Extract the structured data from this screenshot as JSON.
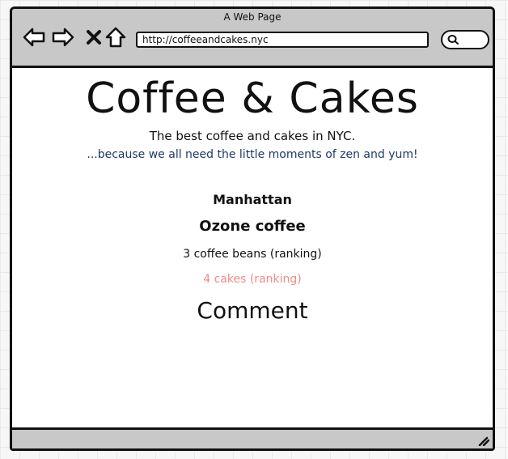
{
  "window": {
    "title": "A Web Page"
  },
  "toolbar": {
    "back_icon": "back-arrow-icon",
    "forward_icon": "forward-arrow-icon",
    "stop_icon": "close-icon",
    "home_icon": "home-icon",
    "search_icon": "search-icon"
  },
  "address_bar": {
    "url": "http://coffeeandcakes.nyc"
  },
  "page": {
    "title": "Coffee & Cakes",
    "subtitle": "The best coffee and cakes in NYC.",
    "tagline": "...because we all need the little moments of zen and yum!",
    "neighborhood": "Manhattan",
    "shop_name": "Ozone coffee",
    "coffee_rank": "3 coffee beans (ranking)",
    "cake_rank": "4 cakes (ranking)",
    "comment_heading": "Comment"
  },
  "colors": {
    "tagline": "#1f3a66",
    "cake_rank": "#f08a8a",
    "chrome": "#c8c8c8"
  }
}
